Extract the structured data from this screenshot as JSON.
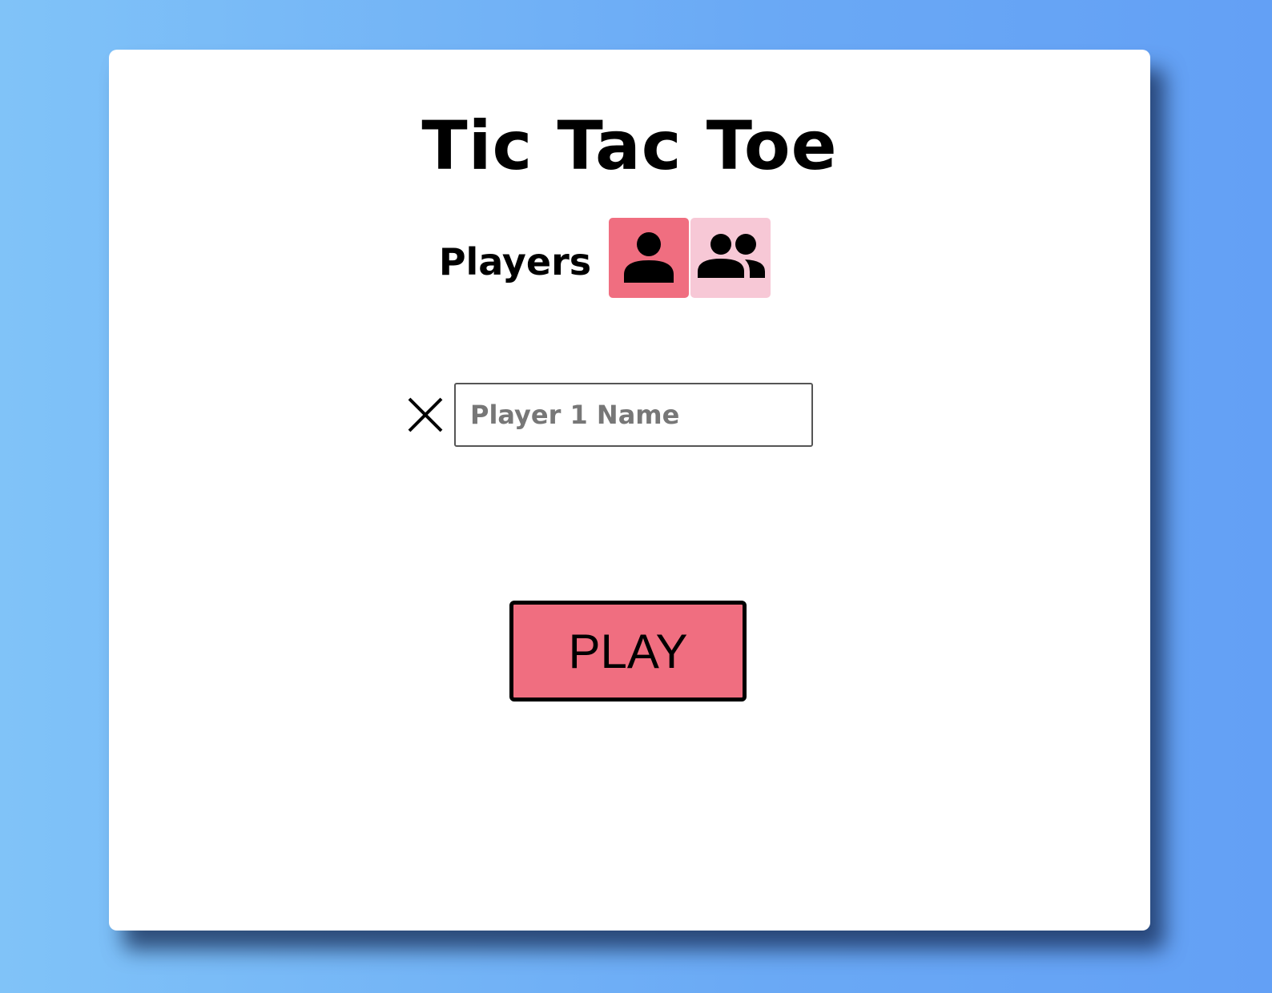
{
  "app": {
    "title": "Tic Tac Toe"
  },
  "players": {
    "label": "Players",
    "modes": [
      {
        "icon": "person-icon",
        "selected": true
      },
      {
        "icon": "people-icon",
        "selected": false
      }
    ]
  },
  "player1": {
    "mark_icon": "x-mark-icon",
    "placeholder": "Player 1 Name",
    "value": ""
  },
  "actions": {
    "play_label": "PLAY"
  },
  "colors": {
    "accent": "#f06e80",
    "accent_light": "#f7c8d6",
    "card": "#ffffff",
    "background_start": "#80c3f8",
    "background_end": "#63a0f5"
  }
}
